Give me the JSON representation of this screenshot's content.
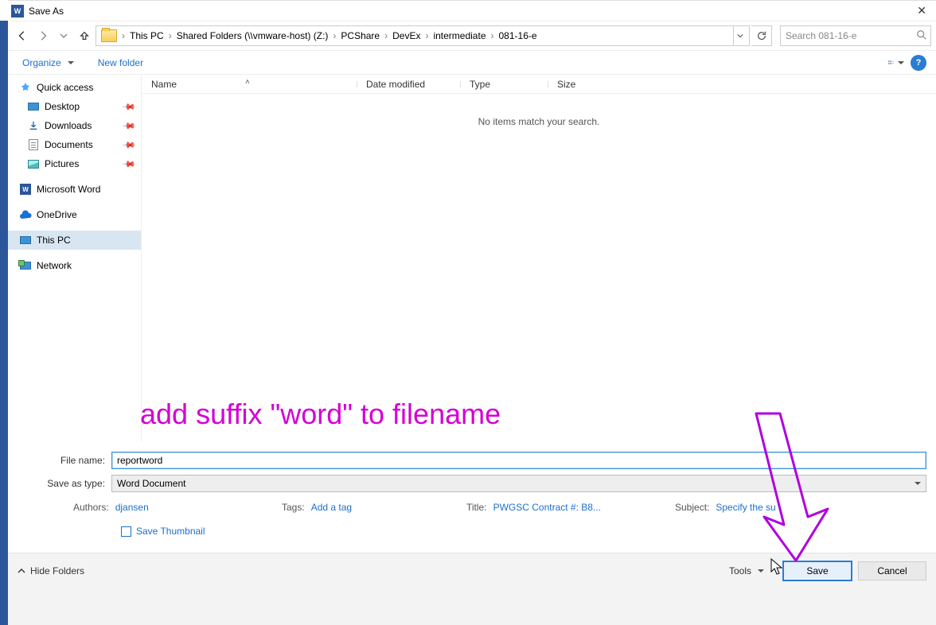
{
  "window": {
    "title": "Save As"
  },
  "nav": {
    "breadcrumbs": [
      "This PC",
      "Shared Folders (\\\\vmware-host) (Z:)",
      "PCShare",
      "DevEx",
      "intermediate",
      "081-16-e"
    ],
    "search_placeholder": "Search 081-16-e"
  },
  "toolbar": {
    "organize": "Organize",
    "new_folder": "New folder"
  },
  "sidebar": {
    "quick": "Quick access",
    "items_pinned": [
      "Desktop",
      "Downloads",
      "Documents",
      "Pictures"
    ],
    "word": "Microsoft Word",
    "onedrive": "OneDrive",
    "thispc": "This PC",
    "network": "Network"
  },
  "columns": {
    "name": "Name",
    "date": "Date modified",
    "type": "Type",
    "size": "Size"
  },
  "list": {
    "empty": "No items match your search."
  },
  "annotation": {
    "text": "add suffix \"word\" to filename"
  },
  "form": {
    "filename_label": "File name:",
    "filename_value": "reportword",
    "type_label": "Save as type:",
    "type_value": "Word Document",
    "authors_label": "Authors:",
    "authors_value": "djansen",
    "tags_label": "Tags:",
    "tags_value": "Add a tag",
    "title_label": "Title:",
    "title_value": "PWGSC Contract #: B8...",
    "subject_label": "Subject:",
    "subject_value": "Specify the su",
    "thumb_label": "Save Thumbnail"
  },
  "footer": {
    "hide": "Hide Folders",
    "tools": "Tools",
    "save": "Save",
    "cancel": "Cancel"
  }
}
